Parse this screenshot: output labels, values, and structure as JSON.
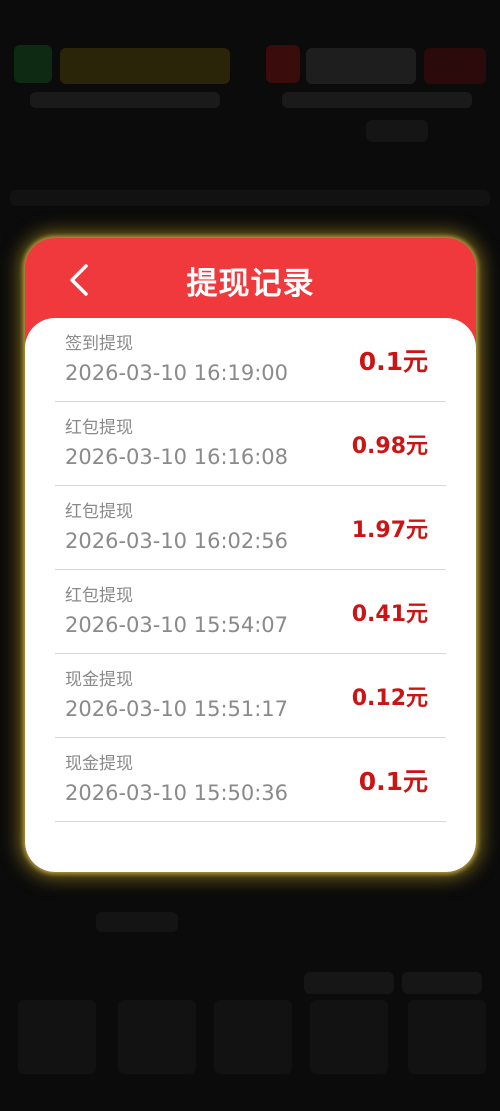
{
  "modal": {
    "title": "提现记录",
    "records": [
      {
        "type": "签到提现",
        "time": "2026-03-10 16:19:00",
        "amount": "0.1元"
      },
      {
        "type": "红包提现",
        "time": "2026-03-10 16:16:08",
        "amount": "0.98元"
      },
      {
        "type": "红包提现",
        "time": "2026-03-10 16:02:56",
        "amount": "1.97元"
      },
      {
        "type": "红包提现",
        "time": "2026-03-10 15:54:07",
        "amount": "0.41元"
      },
      {
        "type": "现金提现",
        "time": "2026-03-10 15:51:17",
        "amount": "0.12元"
      },
      {
        "type": "现金提现",
        "time": "2026-03-10 15:50:36",
        "amount": "0.1元"
      }
    ]
  },
  "colors": {
    "header": "#f0393d",
    "amount": "#cc1414",
    "muted_text": "#8a8a8a"
  },
  "icons": {
    "back": "chevron-left-icon"
  }
}
